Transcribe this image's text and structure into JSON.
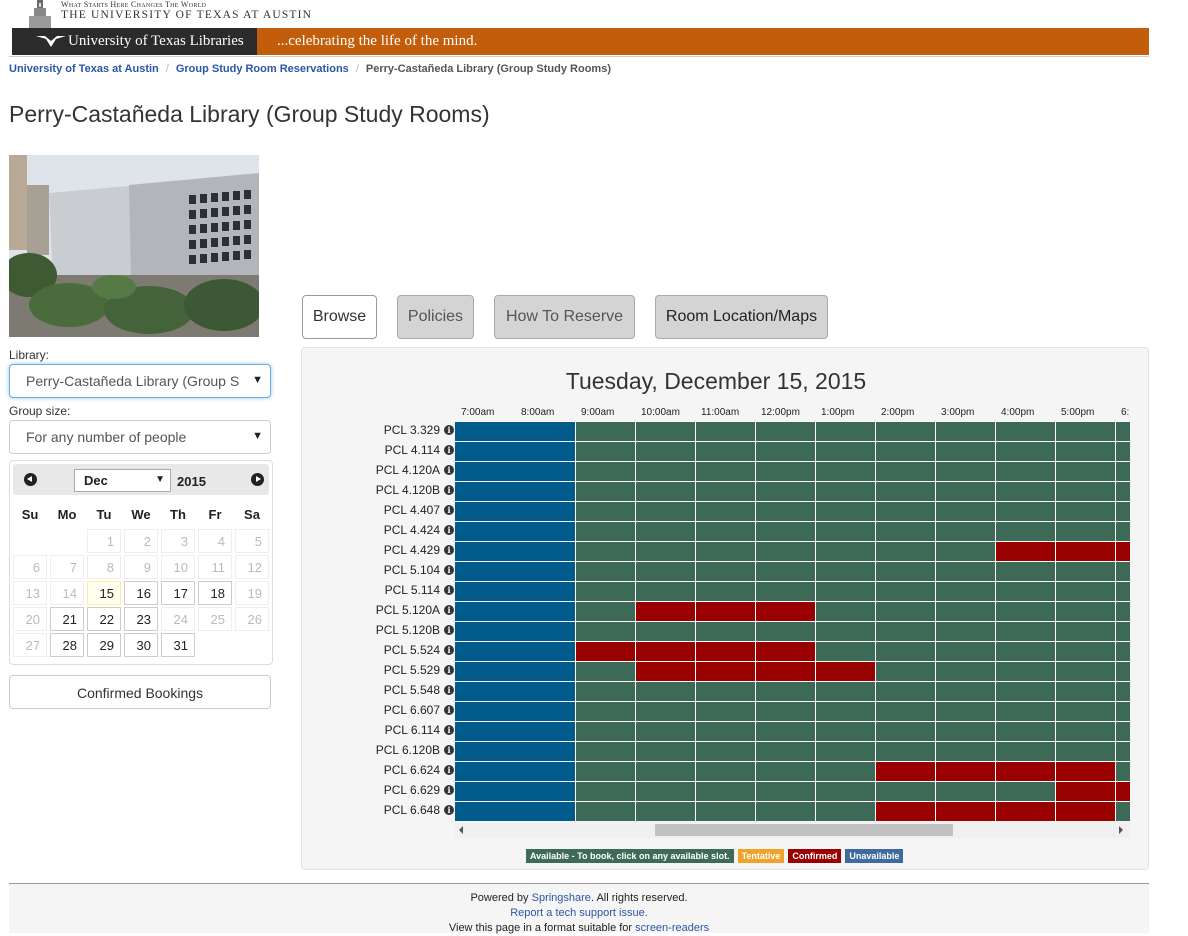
{
  "header": {
    "tagline": "What Starts Here Changes The World",
    "university": "THE UNIVERSITY OF TEXAS AT AUSTIN",
    "library_name": "University of Texas Libraries",
    "motto": "...celebrating the life of the mind."
  },
  "breadcrumb": {
    "items": [
      "University of Texas at Austin",
      "Group Study Room Reservations"
    ],
    "current": "Perry-Castañeda Library (Group Study Rooms)"
  },
  "page": {
    "title": "Perry-Castañeda Library (Group Study Rooms)"
  },
  "filters": {
    "library_label": "Library:",
    "library_value": "Perry-Castañeda Library (Group S",
    "group_label": "Group size:",
    "group_value": "For any number of people"
  },
  "calendar": {
    "month": "Dec",
    "year": "2015",
    "weekdays": [
      "Su",
      "Mo",
      "Tu",
      "We",
      "Th",
      "Fr",
      "Sa"
    ],
    "days": [
      [
        "",
        "",
        "1",
        "2",
        "3",
        "4",
        "5"
      ],
      [
        "6",
        "7",
        "8",
        "9",
        "10",
        "11",
        "12"
      ],
      [
        "13",
        "14",
        "15",
        "16",
        "17",
        "18",
        "19"
      ],
      [
        "20",
        "21",
        "22",
        "23",
        "24",
        "25",
        "26"
      ],
      [
        "27",
        "28",
        "29",
        "30",
        "31",
        "",
        ""
      ]
    ],
    "today": "15",
    "selectable": [
      "15",
      "16",
      "17",
      "18",
      "21",
      "22",
      "23",
      "28",
      "29",
      "30",
      "31"
    ]
  },
  "confirmed_bookings_label": "Confirmed Bookings",
  "tabs": [
    {
      "label": "Browse",
      "active": true
    },
    {
      "label": "Policies",
      "active": false
    },
    {
      "label": "How To Reserve",
      "active": false
    },
    {
      "label": "Room Location/Maps",
      "active": false
    }
  ],
  "grid": {
    "date": "Tuesday, December 15, 2015",
    "times": [
      "7:00am",
      "8:00am",
      "9:00am",
      "10:00am",
      "11:00am",
      "12:00pm",
      "1:00pm",
      "2:00pm",
      "3:00pm",
      "4:00pm",
      "5:00pm",
      "6:"
    ],
    "rooms": [
      {
        "name": "PCL 3.329",
        "slots": "UUAAAAAAAAAA"
      },
      {
        "name": "PCL 4.114",
        "slots": "UUAAAAAAAAAA"
      },
      {
        "name": "PCL 4.120A",
        "slots": "UUAAAAAAAAAA"
      },
      {
        "name": "PCL 4.120B",
        "slots": "UUAAAAAAAAAA"
      },
      {
        "name": "PCL 4.407",
        "slots": "UUAAAAAAAAAA"
      },
      {
        "name": "PCL 4.424",
        "slots": "UUAAAAAAAAAA"
      },
      {
        "name": "PCL 4.429",
        "slots": "UUAAAAAAACCC"
      },
      {
        "name": "PCL 5.104",
        "slots": "UUAAAAAAAAAA"
      },
      {
        "name": "PCL 5.114",
        "slots": "UUAAAAAAAAAA"
      },
      {
        "name": "PCL 5.120A",
        "slots": "UUACCCAAAAAA"
      },
      {
        "name": "PCL 5.120B",
        "slots": "UUAAAAAAAAAA"
      },
      {
        "name": "PCL 5.524",
        "slots": "UUCCCCAAAAAA"
      },
      {
        "name": "PCL 5.529",
        "slots": "UUACCCCAAAAA"
      },
      {
        "name": "PCL 5.548",
        "slots": "UUAAAAAAAAAA"
      },
      {
        "name": "PCL 6.607",
        "slots": "UUAAAAAAAAAA"
      },
      {
        "name": "PCL 6.114",
        "slots": "UUAAAAAAAAAA"
      },
      {
        "name": "PCL 6.120B",
        "slots": "UUAAAAAAAAAA"
      },
      {
        "name": "PCL 6.624",
        "slots": "UUAAAAACCCCA"
      },
      {
        "name": "PCL 6.629",
        "slots": "UUAAAAAAAACC"
      },
      {
        "name": "PCL 6.648",
        "slots": "UUAAAAACCCCA"
      }
    ]
  },
  "legend": [
    {
      "label": "Available - To book, click on any available slot.",
      "color": "#3d6b57"
    },
    {
      "label": "Tentative",
      "color": "#f0a32a"
    },
    {
      "label": "Confirmed",
      "color": "#990000"
    },
    {
      "label": "Unavailable",
      "color": "#3f6a9e"
    }
  ],
  "colors": {
    "available": "#3c6a56",
    "confirmed": "#990000",
    "unavailable": "#005b8a",
    "brand_orange": "#c25d0b"
  },
  "footer": {
    "powered_prefix": "Powered by ",
    "springshare": "Springshare",
    "powered_suffix": ". All rights reserved.",
    "support_link": "Report a tech support issue.",
    "screen_prefix": "View this page in a format suitable for ",
    "screen_link": "screen-readers"
  }
}
